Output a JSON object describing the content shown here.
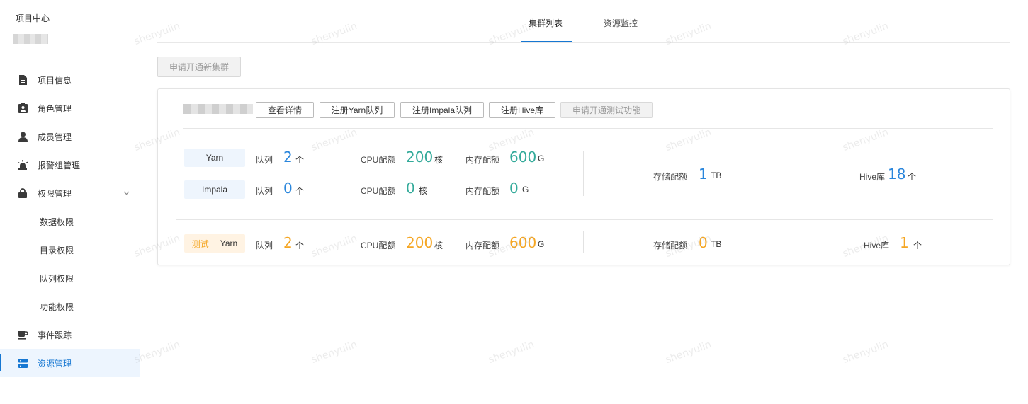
{
  "sidebar": {
    "title": "项目中心",
    "menu": [
      {
        "label": "项目信息",
        "icon": "file-icon"
      },
      {
        "label": "角色管理",
        "icon": "id-badge-icon"
      },
      {
        "label": "成员管理",
        "icon": "user-icon"
      },
      {
        "label": "报警组管理",
        "icon": "alarm-icon"
      },
      {
        "label": "权限管理",
        "icon": "lock-icon"
      },
      {
        "label": "数据权限"
      },
      {
        "label": "目录权限"
      },
      {
        "label": "队列权限"
      },
      {
        "label": "功能权限"
      },
      {
        "label": "事件跟踪",
        "icon": "cup-icon"
      },
      {
        "label": "资源管理",
        "icon": "server-icon",
        "active": true
      }
    ]
  },
  "tabs": [
    {
      "label": "集群列表",
      "active": true
    },
    {
      "label": "资源监控"
    }
  ],
  "apply_button": "申请开通新集群",
  "cluster": {
    "actions": [
      "查看详情",
      "注册Yarn队列",
      "注册Impala队列",
      "注册Hive库",
      "申请开通测试功能"
    ],
    "rows": [
      {
        "tag": "Yarn",
        "queue_label": "队列",
        "queue": "2",
        "queue_unit": "个",
        "cpu_label": "CPU配额",
        "cpu": "200",
        "cpu_unit": "核",
        "mem_label": "内存配额",
        "mem": "600",
        "mem_unit": "G"
      },
      {
        "tag": "Impala",
        "queue_label": "队列",
        "queue": "0",
        "queue_unit": "个",
        "cpu_label": "CPU配额",
        "cpu": "0",
        "cpu_unit": "核",
        "mem_label": "内存配额",
        "mem": "0",
        "mem_unit": "G"
      }
    ],
    "storage": {
      "label": "存储配额",
      "value": "1",
      "unit": "TB"
    },
    "hive": {
      "label": "Hive库",
      "value": "18",
      "unit": "个"
    },
    "test": {
      "tag_prefix": "测试",
      "tag": "Yarn",
      "queue_label": "队列",
      "queue": "2",
      "queue_unit": "个",
      "cpu_label": "CPU配额",
      "cpu": "200",
      "cpu_unit": "核",
      "mem_label": "内存配额",
      "mem": "600",
      "mem_unit": "G",
      "storage_label": "存储配额",
      "storage": "0",
      "storage_unit": "TB",
      "hive_label": "Hive库",
      "hive": "1",
      "hive_unit": "个"
    }
  },
  "colors": {
    "accent": "#1677d2",
    "number_blue": "#2a86dc",
    "number_teal": "#33aa9a",
    "number_orange": "#f5a623"
  },
  "watermark": "shenyulin"
}
